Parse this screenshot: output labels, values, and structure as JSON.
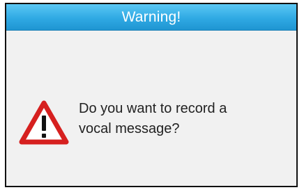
{
  "dialog": {
    "title": "Warning!",
    "icon": "warning-triangle-icon",
    "message_line1": "Do you want to record a",
    "message_line2": "vocal message?"
  },
  "colors": {
    "title_bar": "#2fa9e3",
    "title_text": "#ffffff",
    "background": "#f1f1f1",
    "icon_red": "#d6201f",
    "icon_fill": "#ffffff",
    "text": "#222222"
  }
}
